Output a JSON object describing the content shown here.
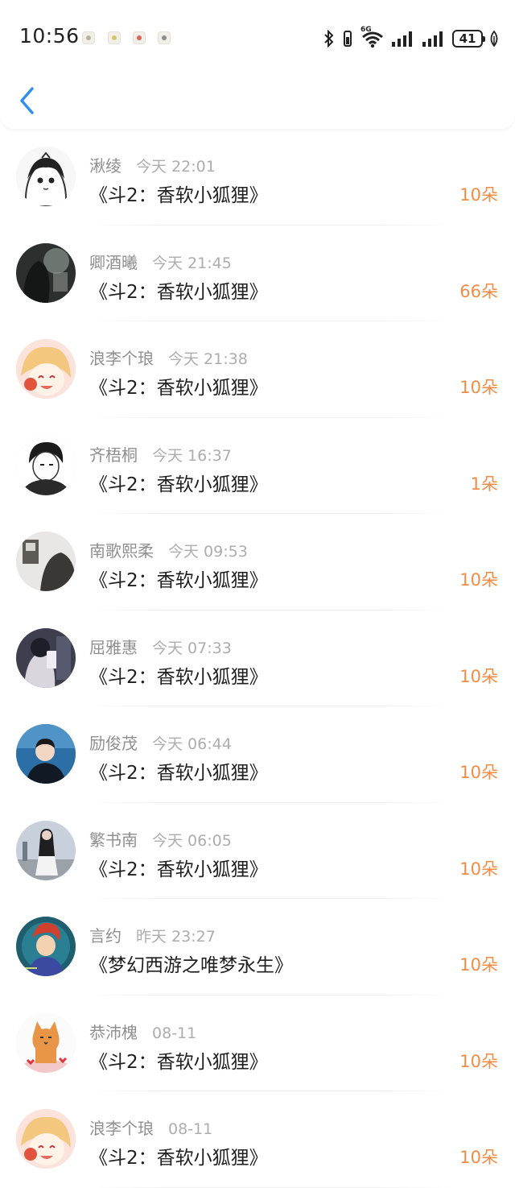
{
  "status_bar": {
    "time": "10:56",
    "network_label": "6G",
    "battery": "41"
  },
  "records": [
    {
      "user": "湫绫",
      "time": "今天 22:01",
      "gift": "《斗2：香软小狐狸》",
      "count": "10朵",
      "avatar": "manga-girl"
    },
    {
      "user": "卿酒曦",
      "time": "今天 21:45",
      "gift": "《斗2：香软小狐狸》",
      "count": "66朵",
      "avatar": "dark-photo"
    },
    {
      "user": "浪李个琅",
      "time": "今天 21:38",
      "gift": "《斗2：香软小狐狸》",
      "count": "10朵",
      "avatar": "anime-pink"
    },
    {
      "user": "齐梧桐",
      "time": "今天 16:37",
      "gift": "《斗2：香软小狐狸》",
      "count": "1朵",
      "avatar": "manga-boy"
    },
    {
      "user": "南歌熙柔",
      "time": "今天 09:53",
      "gift": "《斗2：香软小狐狸》",
      "count": "10朵",
      "avatar": "grey-photo"
    },
    {
      "user": "屈雅惠",
      "time": "今天 07:33",
      "gift": "《斗2：香软小狐狸》",
      "count": "10朵",
      "avatar": "mirror-photo"
    },
    {
      "user": "励俊茂",
      "time": "今天 06:44",
      "gift": "《斗2：香软小狐狸》",
      "count": "10朵",
      "avatar": "blue-boy"
    },
    {
      "user": "繁书南",
      "time": "今天 06:05",
      "gift": "《斗2：香软小狐狸》",
      "count": "10朵",
      "avatar": "street-girl"
    },
    {
      "user": "言约",
      "time": "昨天 23:27",
      "gift": "《梦幻西游之唯梦永生》",
      "count": "10朵",
      "avatar": "game-char"
    },
    {
      "user": "恭沛槐",
      "time": "08-11",
      "gift": "《斗2：香软小狐狸》",
      "count": "10朵",
      "avatar": "cat"
    },
    {
      "user": "浪李个琅",
      "time": "08-11",
      "gift": "《斗2：香软小狐狸》",
      "count": "10朵",
      "avatar": "anime-pink"
    }
  ],
  "colors": {
    "accent_blue": "#2f8ff0",
    "count_orange": "#f08c46",
    "name_grey": "#8f8f8f"
  }
}
